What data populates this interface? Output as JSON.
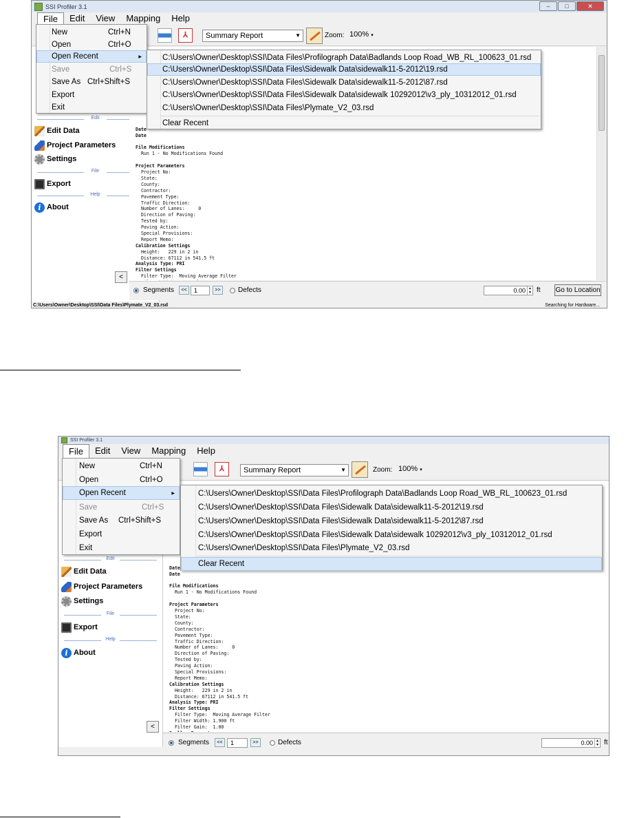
{
  "app": {
    "title": "SSI Profiler 3.1"
  },
  "menubar": [
    "File",
    "Edit",
    "View",
    "Mapping",
    "Help"
  ],
  "file_menu": [
    {
      "label": "New",
      "shortcut": "Ctrl+N",
      "enabled": true
    },
    {
      "label": "Open",
      "shortcut": "Ctrl+O",
      "enabled": true
    },
    {
      "label": "Open Recent",
      "shortcut": "",
      "enabled": true
    },
    {
      "label": "Save",
      "shortcut": "Ctrl+S",
      "enabled": false
    },
    {
      "label": "Save As",
      "shortcut": "Ctrl+Shift+S",
      "enabled": true
    },
    {
      "label": "Export",
      "shortcut": "",
      "enabled": true
    },
    {
      "label": "Exit",
      "shortcut": "",
      "enabled": true
    }
  ],
  "recent_files": [
    "C:\\Users\\Owner\\Desktop\\SSI\\Data Files\\Profilograph Data\\Badlands Loop Road_WB_RL_100623_01.rsd",
    "C:\\Users\\Owner\\Desktop\\SSI\\Data Files\\Sidewalk Data\\sidewalk11-5-2012\\19.rsd",
    "C:\\Users\\Owner\\Desktop\\SSI\\Data Files\\Sidewalk Data\\sidewalk11-5-2012\\87.rsd",
    "C:\\Users\\Owner\\Desktop\\SSI\\Data Files\\Sidewalk Data\\sidewalk 10292012\\v3_ply_10312012_01.rsd",
    "C:\\Users\\Owner\\Desktop\\SSI\\Data Files\\Plymate_V2_03.rsd"
  ],
  "clear_recent": "Clear Recent",
  "toolbar": {
    "report_type": "Summary Report",
    "zoom_label": "Zoom:",
    "zoom_value": "100%"
  },
  "sidebar": {
    "edit_header": "Edit",
    "file_header": "File",
    "help_header": "Help",
    "edit_data": "Edit Data",
    "project_parameters": "Project Parameters",
    "settings": "Settings",
    "export": "Export",
    "about": "About",
    "collapse": "<"
  },
  "report_lines": [
    {
      "t": "Date",
      "b": true
    },
    {
      "t": "Date",
      "b": true
    },
    {
      "t": "",
      "b": false
    },
    {
      "t": "File Modifications",
      "b": true
    },
    {
      "t": "  Run 1 - No Modifications Found",
      "b": false
    },
    {
      "t": "",
      "b": false
    },
    {
      "t": "Project Parameters",
      "b": true
    },
    {
      "t": "  Project No:",
      "b": false
    },
    {
      "t": "  State:",
      "b": false
    },
    {
      "t": "  County:",
      "b": false
    },
    {
      "t": "  Contractor:",
      "b": false
    },
    {
      "t": "  Pavement Type:",
      "b": false
    },
    {
      "t": "  Traffic Direction:",
      "b": false
    },
    {
      "t": "  Number of Lanes:     0",
      "b": false
    },
    {
      "t": "  Direction of Paving:",
      "b": false
    },
    {
      "t": "  Tested by:",
      "b": false
    },
    {
      "t": "  Paving Action:",
      "b": false
    },
    {
      "t": "  Special Provisions:",
      "b": false
    },
    {
      "t": "  Report Memo:",
      "b": false
    },
    {
      "t": "Calibration Settings",
      "b": true
    },
    {
      "t": "  Height:   229 in 2 in",
      "b": false
    },
    {
      "t": "  Distance: 67112 in 541.5 ft",
      "b": false
    },
    {
      "t": "Analysis Type: PRI",
      "b": true
    },
    {
      "t": "Filter Settings",
      "b": true
    },
    {
      "t": "  Filter Type:  Moving Average Filter",
      "b": false
    },
    {
      "t": "  Filter Width: 1.900 ft",
      "b": false
    },
    {
      "t": "  Filter Gain:  1.00",
      "b": false
    },
    {
      "t": "Scallop Parameters",
      "b": true
    }
  ],
  "bottom": {
    "segments": "Segments",
    "prev": "<<",
    "segment_value": "1",
    "next": ">>",
    "defects": "Defects",
    "location_value": "0.00",
    "unit": "ft",
    "goto": "Go to Location"
  },
  "status": {
    "path": "C:\\Users\\Owner\\Desktop\\SSI\\Data Files\\Plymate_V2_03.rsd",
    "message": "Searching for Hardware..."
  }
}
